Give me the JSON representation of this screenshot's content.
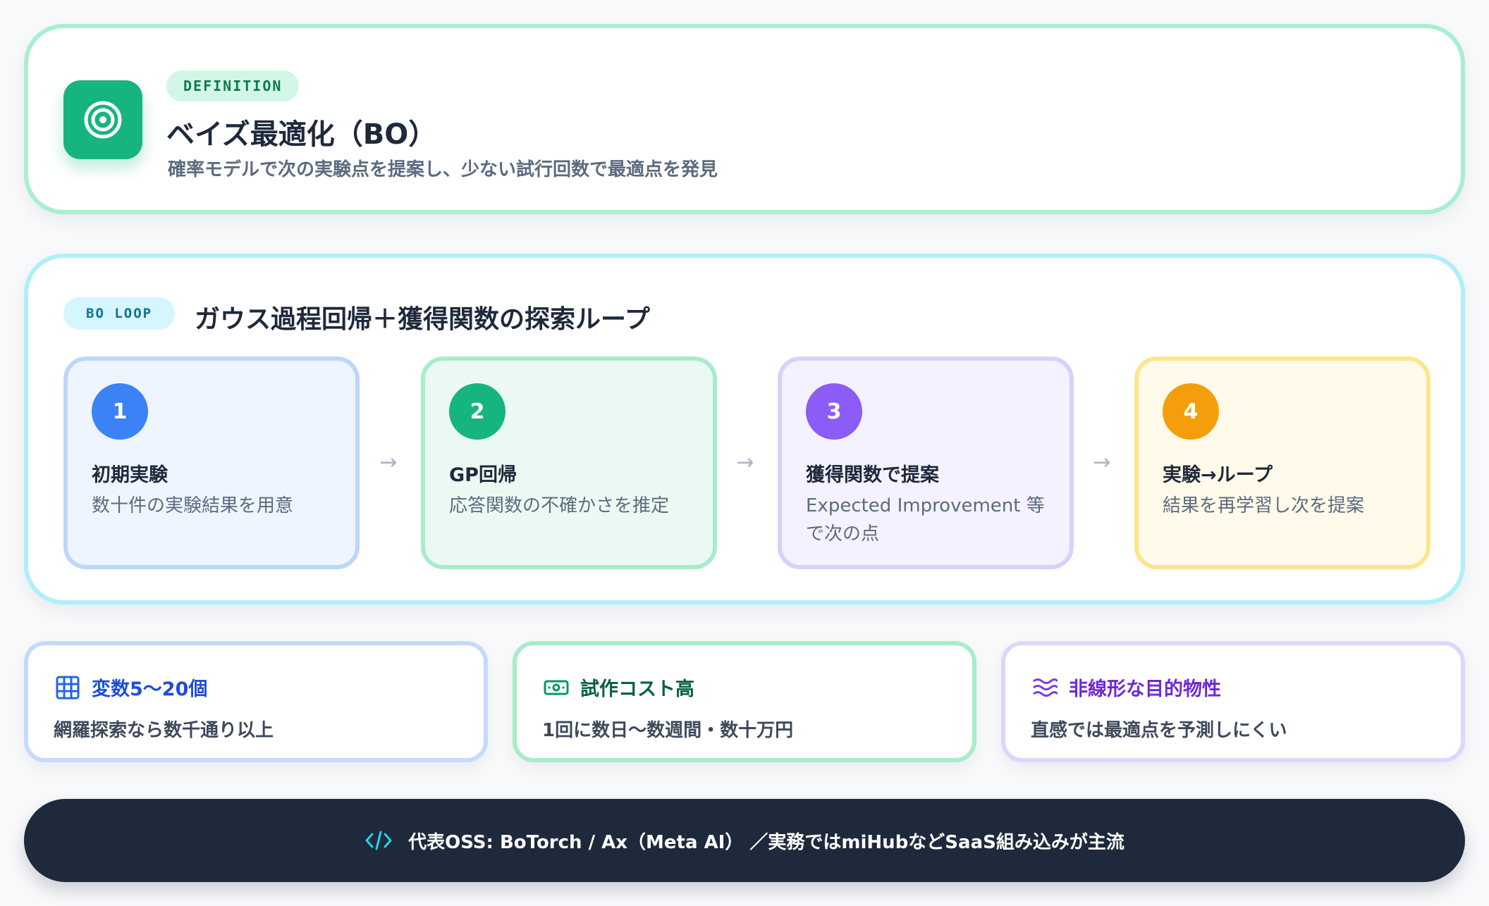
{
  "definition": {
    "tag": "DEFINITION",
    "title": "ベイズ最適化（BO）",
    "subtitle": "確率モデルで次の実験点を提案し、少ない試行回数で最適点を発見",
    "icon": "target-icon"
  },
  "loop": {
    "tag": "BO LOOP",
    "title": "ガウス過程回帰＋獲得関数の探索ループ",
    "steps": [
      {
        "num": "1",
        "title": "初期実験",
        "desc": "数十件の実験結果を用意",
        "color": "#3b82f6"
      },
      {
        "num": "2",
        "title": "GP回帰",
        "desc": "応答関数の不確かさを推定",
        "color": "#16b57d"
      },
      {
        "num": "3",
        "title": "獲得関数で提案",
        "desc": "Expected Improvement 等で次の点",
        "color": "#8b5cf6"
      },
      {
        "num": "4",
        "title": "実験→ループ",
        "desc": "結果を再学習し次を提案",
        "color": "#f59e0b"
      }
    ]
  },
  "features": [
    {
      "icon": "grid-icon",
      "title": "変数5〜20個",
      "desc": "網羅探索なら数千通り以上"
    },
    {
      "icon": "money-icon",
      "title": "試作コスト高",
      "desc": "1回に数日〜数週間・数十万円"
    },
    {
      "icon": "waves-icon",
      "title": "非線形な目的物性",
      "desc": "直感では最適点を予測しにくい"
    }
  ],
  "footer": {
    "icon": "code-icon",
    "text": "代表OSS: BoTorch / Ax（Meta AI） ／実務ではmiHubなどSaaS組み込みが主流"
  }
}
